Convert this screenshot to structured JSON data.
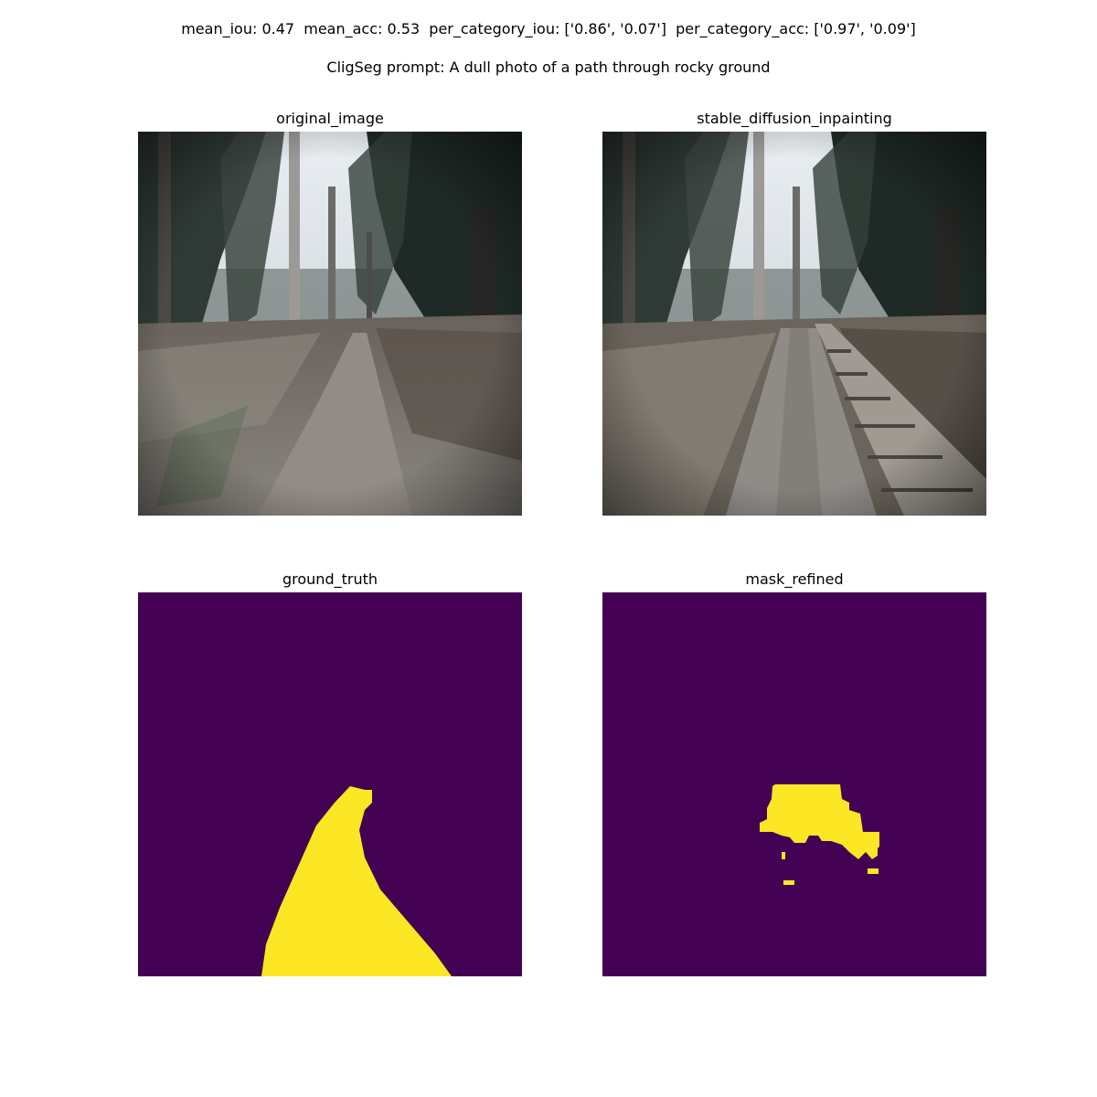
{
  "header": {
    "metrics": "mean_iou: 0.47  mean_acc: 0.53  per_category_iou: ['0.86', '0.07']  per_category_acc: ['0.97', '0.09']",
    "prompt": "CligSeg prompt: A dull photo of a path through rocky ground"
  },
  "panels": {
    "original": {
      "title": "original_image"
    },
    "inpainting": {
      "title": "stable_diffusion_inpainting"
    },
    "ground_truth": {
      "title": "ground_truth"
    },
    "mask_refined": {
      "title": "mask_refined"
    }
  },
  "colors": {
    "mask_background": "#440154",
    "mask_foreground": "#fde725"
  }
}
